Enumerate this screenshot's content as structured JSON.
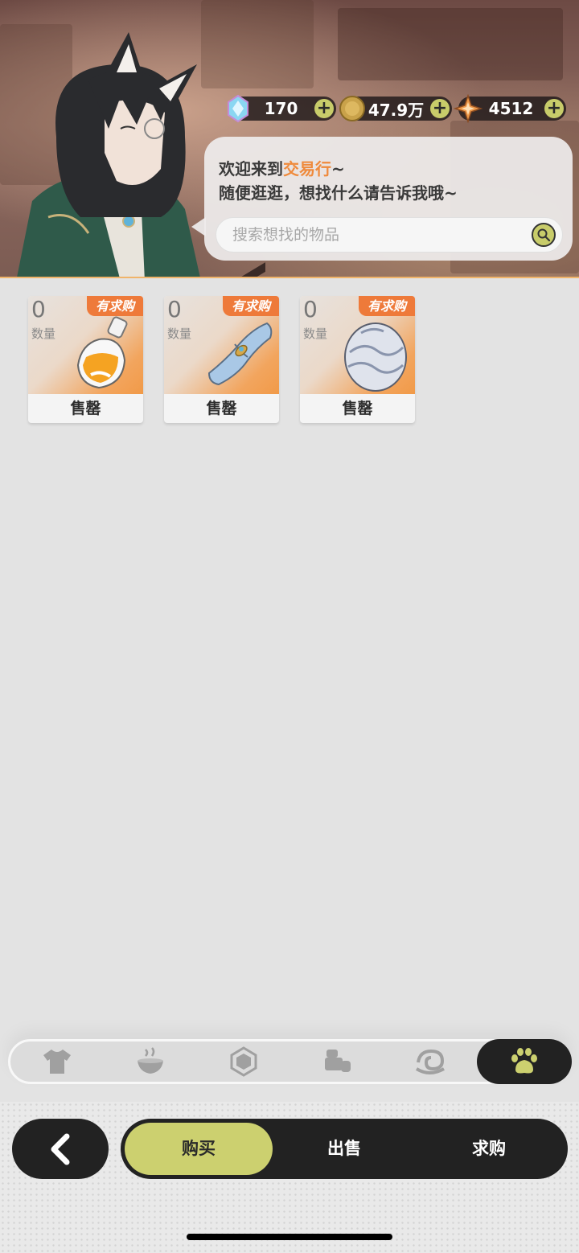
{
  "currencies": [
    {
      "icon": "crystal-icon",
      "value": "170"
    },
    {
      "icon": "gold-coin-icon",
      "value": "47.9万"
    },
    {
      "icon": "star-gem-icon",
      "value": "4512"
    }
  ],
  "greeting": {
    "line1_prefix": "欢迎来到",
    "line1_highlight": "交易行",
    "line1_suffix": "~",
    "line2": "随便逛逛，想找什么请告诉我哦~"
  },
  "search": {
    "placeholder": "搜索想找的物品"
  },
  "items": [
    {
      "quantity": "0",
      "quantity_label": "数量",
      "badge": "有求购",
      "status": "售罄",
      "icon": "potion-bottle-icon"
    },
    {
      "quantity": "0",
      "quantity_label": "数量",
      "badge": "有求购",
      "status": "售罄",
      "icon": "scroll-icon"
    },
    {
      "quantity": "0",
      "quantity_label": "数量",
      "badge": "有求购",
      "status": "售罄",
      "icon": "egg-icon"
    }
  ],
  "categories": [
    {
      "icon": "shirt-icon",
      "active": false
    },
    {
      "icon": "food-bowl-icon",
      "active": false
    },
    {
      "icon": "gem-icon",
      "active": false
    },
    {
      "icon": "furniture-icon",
      "active": false
    },
    {
      "icon": "swirl-icon",
      "active": false
    },
    {
      "icon": "paw-icon",
      "active": true
    }
  ],
  "modes": [
    {
      "label": "购买",
      "active": true
    },
    {
      "label": "出售",
      "active": false
    },
    {
      "label": "求购",
      "active": false
    }
  ],
  "colors": {
    "accent": "#ccd06f",
    "highlight_text": "#ef8a3c",
    "badge": "#ee7a3a",
    "dark": "#222222"
  }
}
